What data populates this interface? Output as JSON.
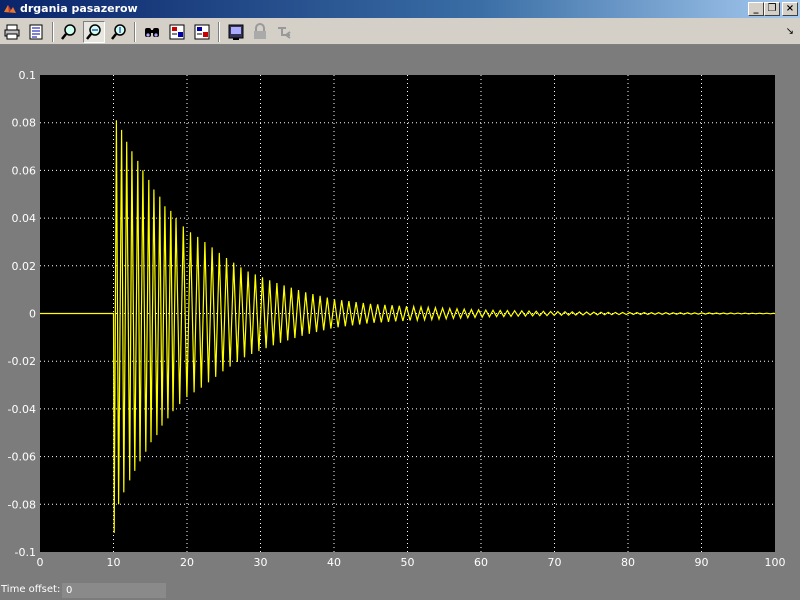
{
  "window": {
    "title": "drgania pasazerow",
    "icon": "matlab-icon",
    "buttons": [
      "minimize-icon",
      "restore-icon",
      "close-icon"
    ]
  },
  "toolbar": {
    "items": [
      "print-icon",
      "parameters-icon",
      "zoom-icon",
      "zoom-x-icon",
      "zoom-y-icon",
      "autoscale-icon",
      "save-axes-icon",
      "restore-axes-icon",
      "float-scope-icon",
      "lock-axes-icon",
      "signal-selection-icon"
    ],
    "pressed": "zoom-x-icon"
  },
  "status": {
    "label": "Time offset:",
    "value": "0"
  },
  "colors": {
    "plot_background": "#000000",
    "signal": "#ffff00",
    "grid": "#ffffff",
    "axis_text": "#ffffff",
    "frame": "#7c7c7c"
  },
  "chart_data": {
    "type": "line",
    "title": "",
    "xlabel": "",
    "ylabel": "",
    "xlim": [
      0,
      100
    ],
    "ylim": [
      -0.1,
      0.1
    ],
    "xticks": [
      "0",
      "10",
      "20",
      "30",
      "40",
      "50",
      "60",
      "70",
      "80",
      "90",
      "100"
    ],
    "yticks": [
      "-0.1",
      "-0.08",
      "-0.06",
      "-0.04",
      "-0.02",
      "0",
      "0.02",
      "0.04",
      "0.06",
      "0.08",
      "0.1"
    ],
    "grid": true,
    "series": [
      {
        "color": "#ffff00",
        "x": [
          0,
          10,
          10.1,
          10.4,
          10.7,
          11.1,
          11.4,
          11.8,
          12.2,
          12.5,
          12.9,
          13.3,
          13.6,
          14.0,
          14.4,
          14.8,
          15.1,
          15.5,
          15.9,
          16.3,
          16.6,
          17.0,
          17.4,
          17.8,
          18.1,
          18.5,
          19.0,
          20.0,
          22.0,
          25.0,
          28.0,
          32.0,
          36.0,
          40.0,
          45.0,
          50.0,
          60.0,
          70.0,
          80.0,
          100.0
        ],
        "y": [
          0,
          0,
          -0.092,
          0.081,
          -0.08,
          0.077,
          -0.075,
          0.072,
          -0.07,
          0.068,
          -0.066,
          0.064,
          -0.062,
          0.06,
          -0.058,
          0.056,
          -0.054,
          0.052,
          -0.051,
          0.049,
          -0.047,
          0.045,
          -0.044,
          0.043,
          -0.041,
          0.04,
          -0.038,
          0.035,
          0.031,
          0.024,
          0.018,
          0.013,
          0.009,
          0.006,
          0.004,
          0.003,
          0.0015,
          0.0008,
          0.0004,
          0.0001
        ]
      }
    ]
  }
}
